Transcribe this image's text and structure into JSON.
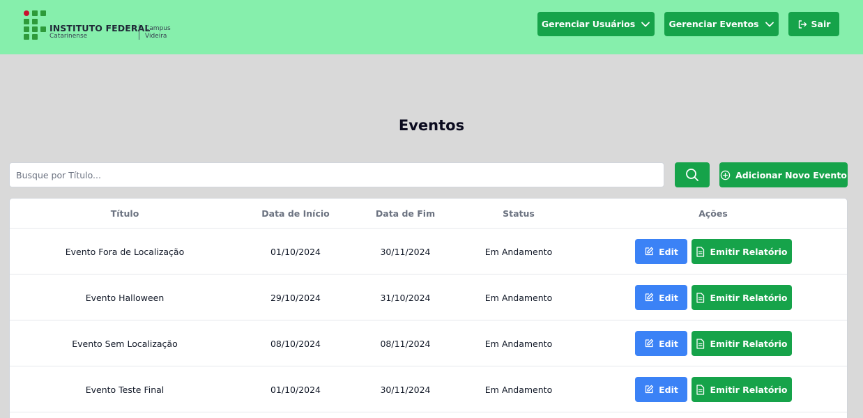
{
  "header": {
    "logo": {
      "title": "INSTITUTO FEDERAL",
      "subtitle": "Catarinense",
      "campus_line1": "Campus",
      "campus_line2": "Videira"
    },
    "nav": {
      "manage_users": "Gerenciar Usuários",
      "manage_events": "Gerenciar Eventos",
      "logout": "Sair"
    }
  },
  "page": {
    "title": "Eventos"
  },
  "search": {
    "placeholder": "Busque por Título...",
    "value": ""
  },
  "actions": {
    "add_event": "Adicionar Novo Evento"
  },
  "table": {
    "columns": [
      "Título",
      "Data de Início",
      "Data de Fim",
      "Status",
      "Ações"
    ],
    "rows": [
      {
        "title": "Evento Fora de Localização",
        "start": "01/10/2024",
        "end": "30/11/2024",
        "status": "Em Andamento"
      },
      {
        "title": "Evento Halloween",
        "start": "29/10/2024",
        "end": "31/10/2024",
        "status": "Em Andamento"
      },
      {
        "title": "Evento Sem Localização",
        "start": "08/10/2024",
        "end": "08/11/2024",
        "status": "Em Andamento"
      },
      {
        "title": "Evento Teste Final",
        "start": "01/10/2024",
        "end": "30/11/2024",
        "status": "Em Andamento"
      }
    ],
    "row_actions": {
      "edit": "Edit",
      "report": "Emitir Relatório"
    }
  },
  "colors": {
    "header_bg": "#86efac",
    "primary_green": "#16a34a",
    "edit_blue": "#3b82f6",
    "page_bg": "#d9d9d9",
    "logo_red": "#c8102e",
    "logo_green": "#2e9a3a"
  },
  "icons": {
    "manage_users": "chevron-down-icon",
    "manage_events": "chevron-down-icon",
    "logout": "logout-icon",
    "search": "search-icon",
    "add_event": "plus-circle-icon",
    "edit": "edit-icon",
    "report": "document-icon"
  }
}
